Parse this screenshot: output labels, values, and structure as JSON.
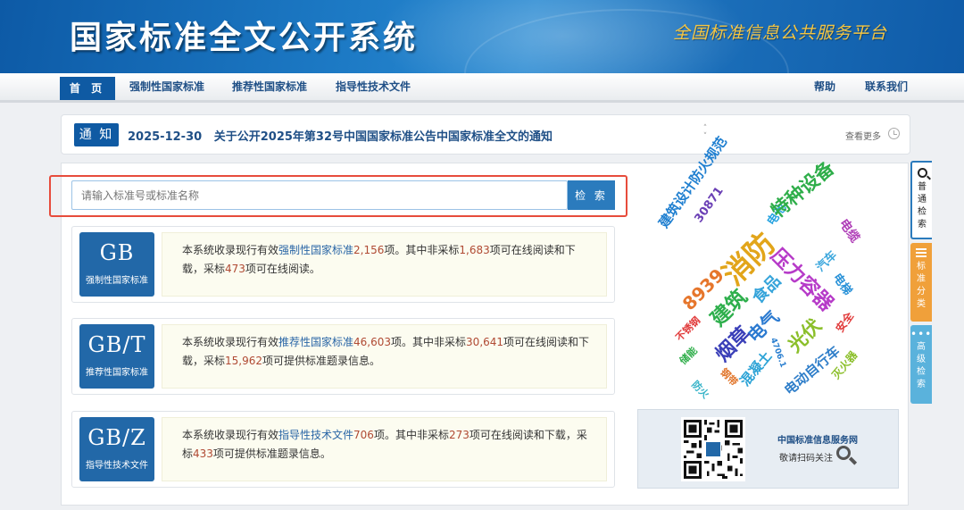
{
  "header": {
    "title": "国家标准全文公开系统",
    "slogan": "全国标准信息公共服务平台"
  },
  "nav": {
    "home": "首 页",
    "mandatory": "强制性国家标准",
    "recommended": "推荐性国家标准",
    "guidance": "指导性技术文件",
    "help": "帮助",
    "contact": "联系我们"
  },
  "notice": {
    "badge": "通 知",
    "text": "2025-12-30   关于公开2025年第32号中国国家标准公告中国家标准全文的通知",
    "more": "查看更多"
  },
  "search": {
    "placeholder": "请输入标准号或标准名称",
    "button": "检 索"
  },
  "categories": [
    {
      "code": "GB",
      "name": "强制性国家标准",
      "p1": "本系统收录现行有效",
      "hl": "强制性国家标准",
      "total": "2,156",
      "p2": "项。其中非采标",
      "nonadopt": "1,683",
      "p3": "项可在线阅读和下载，采标",
      "adopt": "473",
      "p4": "项可在线阅读。"
    },
    {
      "code": "GB/T",
      "name": "推荐性国家标准",
      "p1": "本系统收录现行有效",
      "hl": "推荐性国家标准",
      "total": "46,603",
      "p2": "项。其中非采标",
      "nonadopt": "30,641",
      "p3": "项可在线阅读和下载，采标",
      "adopt": "15,962",
      "p4": "项可提供标准题录信息。"
    },
    {
      "code": "GB/Z",
      "name": "指导性技术文件",
      "p1": "本系统收录现行有效",
      "hl": "指导性技术文件",
      "total": "706",
      "p2": "项。其中非采标",
      "nonadopt": "273",
      "p3": "项可在线阅读和下载，采标",
      "adopt": "433",
      "p4": "项可提供标准题录信息。"
    }
  ],
  "word_cloud": [
    {
      "text": "30871",
      "color": "#6a3fb5"
    },
    {
      "text": "建筑设计防火规范",
      "color": "#1f7fd0"
    },
    {
      "text": "电池",
      "color": "#26a3e0"
    },
    {
      "text": "特种设备",
      "color": "#2fae4a"
    },
    {
      "text": "电缆",
      "color": "#b03fb8"
    },
    {
      "text": "消防",
      "color": "#e2a51a"
    },
    {
      "text": "压力容器",
      "color": "#b63ac8"
    },
    {
      "text": "汽车",
      "color": "#3ea8dd"
    },
    {
      "text": "8939",
      "color": "#e6762c"
    },
    {
      "text": "建筑",
      "color": "#2eaf4c"
    },
    {
      "text": "食品",
      "color": "#36a4da"
    },
    {
      "text": "电梯",
      "color": "#2a92d8"
    },
    {
      "text": "不锈钢",
      "color": "#e13a3a"
    },
    {
      "text": "电气",
      "color": "#2b7ad0"
    },
    {
      "text": "光伏",
      "color": "#8bbf2a"
    },
    {
      "text": "安全",
      "color": "#e13a3a"
    },
    {
      "text": "烟草",
      "color": "#3a3fb8"
    },
    {
      "text": "储能",
      "color": "#2fae4a"
    },
    {
      "text": "混凝土",
      "color": "#2ca3d6"
    },
    {
      "text": "4706.1",
      "color": "#2a7fd0"
    },
    {
      "text": "电动自行车",
      "color": "#2f7ec9"
    },
    {
      "text": "钢带",
      "color": "#e1762c"
    },
    {
      "text": "灭火器",
      "color": "#8bbf2a"
    },
    {
      "text": "防火",
      "color": "#36b3c8"
    }
  ],
  "qr": {
    "title": "中国标准信息服务网",
    "hint": "敬请扫码关注"
  },
  "side_tabs": {
    "normal": "普通检索",
    "classify": "标准分类",
    "advanced": "高级检索"
  },
  "colors": {
    "brand_blue": "#0f5aa3",
    "highlight_red": "#e74c3c",
    "number_red": "#b04a33",
    "slogan_gold": "#f4c542"
  }
}
